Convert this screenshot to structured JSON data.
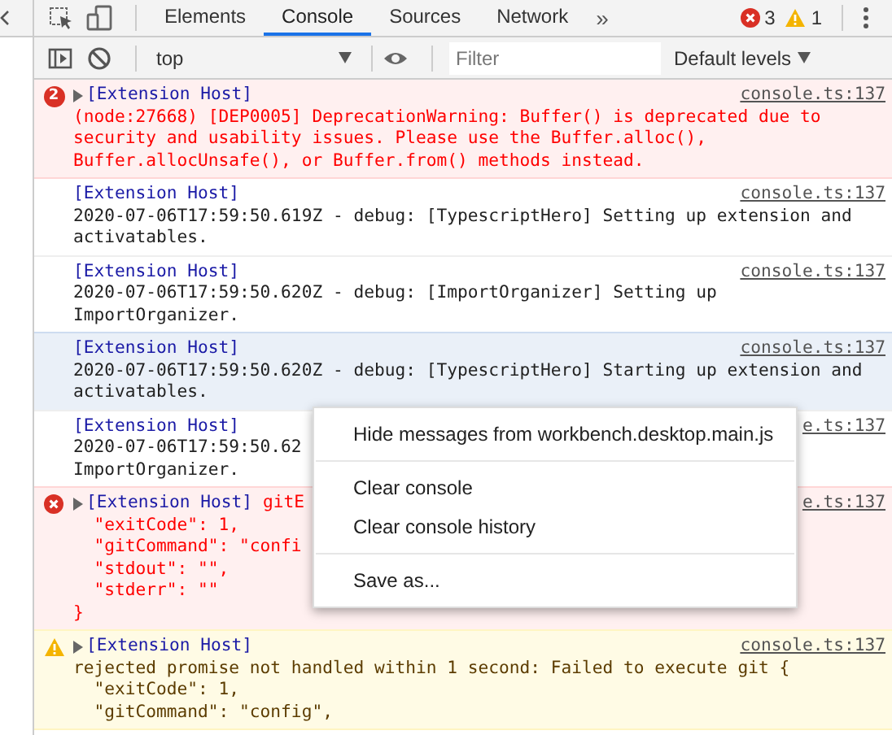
{
  "tabs": [
    {
      "label": "Elements",
      "selected": false
    },
    {
      "label": "Console",
      "selected": true
    },
    {
      "label": "Sources",
      "selected": false
    },
    {
      "label": "Network",
      "selected": false
    }
  ],
  "more_tabs": "»",
  "error_count": "3",
  "warning_count": "1",
  "context": {
    "value": "top"
  },
  "filter": {
    "placeholder": "Filter"
  },
  "levels": {
    "label": "Default levels"
  },
  "messages": [
    {
      "kind": "error",
      "count": "2",
      "expandable": true,
      "selected": false,
      "source": "[Extension Host]",
      "link": "console.ts:137",
      "body": "(node:27668) [DEP0005] DeprecationWarning: Buffer() is deprecated due to\nsecurity and usability issues. Please use the Buffer.alloc(),\nBuffer.allocUnsafe(), or Buffer.from() methods instead."
    },
    {
      "kind": "info",
      "expandable": false,
      "selected": false,
      "source": "[Extension Host]",
      "link": "console.ts:137",
      "body": "2020-07-06T17:59:50.619Z - debug: [TypescriptHero] Setting up extension and\nactivatables."
    },
    {
      "kind": "info",
      "expandable": false,
      "selected": false,
      "source": "[Extension Host]",
      "link": "console.ts:137",
      "body": "2020-07-06T17:59:50.620Z - debug: [ImportOrganizer] Setting up\nImportOrganizer."
    },
    {
      "kind": "info",
      "expandable": false,
      "selected": true,
      "source": "[Extension Host]",
      "link": "console.ts:137",
      "body": "2020-07-06T17:59:50.620Z - debug: [TypescriptHero] Starting up extension and\nactivatables."
    },
    {
      "kind": "info",
      "expandable": false,
      "selected": false,
      "source": "[Extension Host]",
      "link": "e.ts:137",
      "body": "2020-07-06T17:59:50.62\nImportOrganizer."
    },
    {
      "kind": "error",
      "expandable": true,
      "selected": false,
      "source": "[Extension Host]",
      "inline": "gitE",
      "link": "e.ts:137",
      "body": "  \"exitCode\": 1,\n  \"gitCommand\": \"confi\n  \"stdout\": \"\",\n  \"stderr\": \"\"\n}"
    },
    {
      "kind": "warning",
      "expandable": true,
      "selected": false,
      "source": "[Extension Host]",
      "link": "console.ts:137",
      "body": "rejected promise not handled within 1 second: Failed to execute git {\n  \"exitCode\": 1,\n  \"gitCommand\": \"config\","
    }
  ],
  "context_menu": {
    "groups": [
      [
        "Hide messages from workbench.desktop.main.js"
      ],
      [
        "Clear console",
        "Clear console history"
      ],
      [
        "Save as..."
      ]
    ]
  }
}
